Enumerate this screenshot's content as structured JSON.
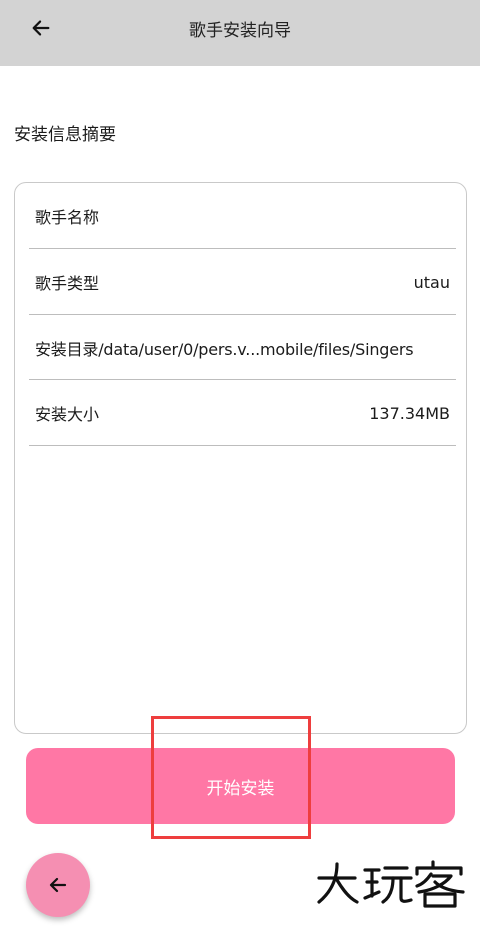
{
  "header": {
    "title": "歌手安装向导",
    "back_icon": "arrow-left-icon"
  },
  "summary": {
    "title": "安装信息摘要",
    "rows": [
      {
        "label": "歌手名称",
        "value": ""
      },
      {
        "label": "歌手类型",
        "value": "utau"
      },
      {
        "label": "安装目录",
        "value": "/data/user/0/pers.v...mobile/files/Singers"
      },
      {
        "label": "安装大小",
        "value": "137.34MB"
      }
    ]
  },
  "actions": {
    "install_label": "开始安装",
    "fab_icon": "arrow-left-icon"
  },
  "watermark": {
    "text": "大玩客"
  },
  "colors": {
    "topbar": "#d3d3d3",
    "accent": "#ff77a5",
    "fab": "#f58fb2",
    "highlight": "#ee3e3e"
  }
}
